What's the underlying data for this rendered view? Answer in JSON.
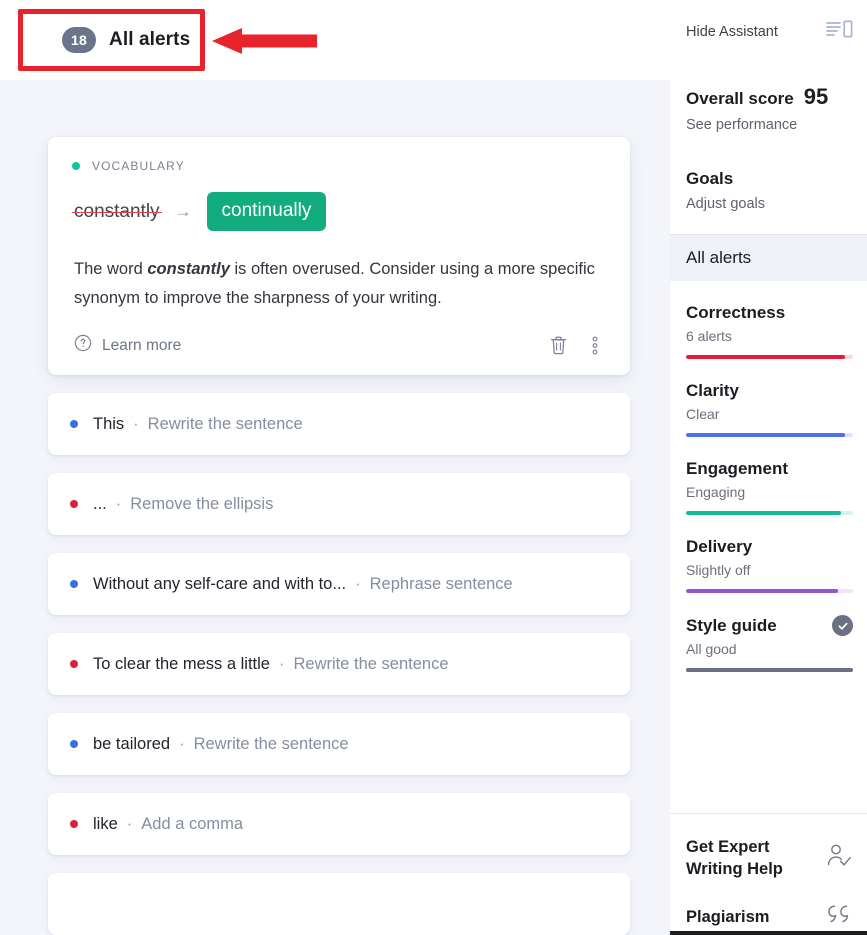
{
  "header": {
    "alerts_count": "18",
    "alerts_label": "All alerts"
  },
  "featured_card": {
    "category": "VOCABULARY",
    "category_color": "#15c39a",
    "original_word": "constantly",
    "arrow": "→",
    "replacement_word": "continually",
    "replacement_bg": "#13ac7f",
    "description_prefix": "The word ",
    "description_bold": "constantly",
    "description_suffix": " is often overused. Consider using a more specific synonym to improve the sharpness of your writing.",
    "learn_more_label": "Learn more",
    "help_icon": "question-circle-icon",
    "delete_icon": "trash-icon",
    "more_icon": "more-vertical-icon"
  },
  "alert_rows": [
    {
      "text": "This",
      "separator": "·",
      "action": "Rewrite the sentence",
      "dot_color": "#3b6ee0"
    },
    {
      "text": "...",
      "separator": "·",
      "action": "Remove the ellipsis",
      "dot_color": "#e01e3c"
    },
    {
      "text": "Without any self-care and with to...",
      "separator": "·",
      "action": "Rephrase sentence",
      "dot_color": "#3b6ee0"
    },
    {
      "text": "To clear the mess a little",
      "separator": "·",
      "action": "Rewrite the sentence",
      "dot_color": "#e01e3c"
    },
    {
      "text": "be tailored",
      "separator": "·",
      "action": "Rewrite the sentence",
      "dot_color": "#3b6ee0"
    },
    {
      "text": "like",
      "separator": "·",
      "action": "Add a comma",
      "dot_color": "#e01e3c"
    }
  ],
  "sidebar": {
    "hide_assistant_label": "Hide Assistant",
    "hide_assistant_icon": "panel-collapse-icon",
    "overall_score_label": "Overall score",
    "overall_score_value": "95",
    "see_performance_label": "See performance",
    "goals_label": "Goals",
    "adjust_goals_label": "Adjust goals",
    "all_alerts_label": "All alerts",
    "metrics": [
      {
        "title": "Correctness",
        "sub": "6 alerts",
        "color": "#e8193b",
        "track": "#fbd8de",
        "fill_pct": "95%"
      },
      {
        "title": "Clarity",
        "sub": "Clear",
        "color": "#4a71e8",
        "track": "#dce4fb",
        "fill_pct": "95%"
      },
      {
        "title": "Engagement",
        "sub": "Engaging",
        "color": "#13bb99",
        "track": "#d4f3ec",
        "fill_pct": "93%"
      },
      {
        "title": "Delivery",
        "sub": "Slightly off",
        "color": "#9455cf",
        "track": "#f1e2fa",
        "fill_pct": "91%"
      },
      {
        "title": "Style guide",
        "sub": "All good",
        "color": "#6b7183",
        "track": "#6b7183",
        "fill_pct": "100%",
        "badge_icon": "check-circle-icon"
      }
    ],
    "expert_help_label_line1": "Get Expert",
    "expert_help_label_line2": "Writing Help",
    "expert_help_icon": "person-check-icon",
    "plagiarism_label": "Plagiarism",
    "plagiarism_icon": "quote-marks-icon"
  },
  "annotations": {
    "highlight_box_color": "#e8232a",
    "arrow_color": "#e8232a",
    "arrow_icon": "left-arrow-annotation"
  }
}
